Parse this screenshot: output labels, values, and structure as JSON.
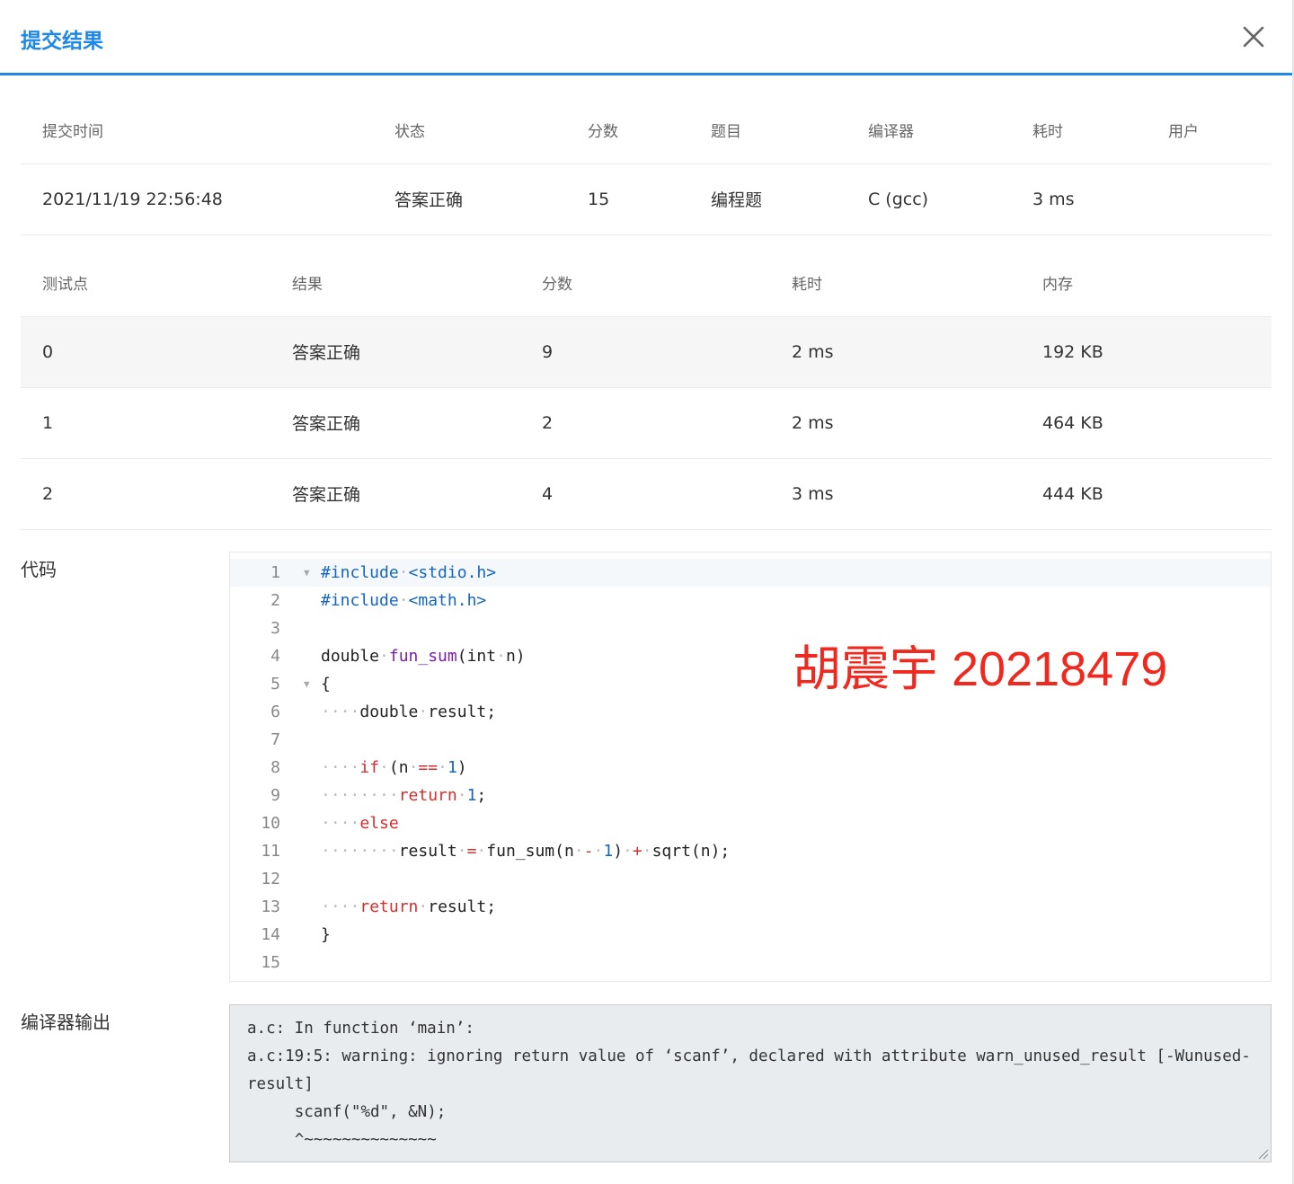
{
  "dialog": {
    "title": "提交结果",
    "close_icon": "close-icon"
  },
  "summary": {
    "headers": [
      "提交时间",
      "状态",
      "分数",
      "题目",
      "编译器",
      "耗时",
      "用户"
    ],
    "row": {
      "submit_time": "2021/11/19 22:56:48",
      "status": "答案正确",
      "score": "15",
      "problem": "编程题",
      "compiler": "C (gcc)",
      "time": "3 ms",
      "user": ""
    }
  },
  "cases": {
    "headers": [
      "测试点",
      "结果",
      "分数",
      "耗时",
      "内存"
    ],
    "rows": [
      {
        "id": "0",
        "result": "答案正确",
        "score": "9",
        "time": "2 ms",
        "memory": "192 KB"
      },
      {
        "id": "1",
        "result": "答案正确",
        "score": "2",
        "time": "2 ms",
        "memory": "464 KB"
      },
      {
        "id": "2",
        "result": "答案正确",
        "score": "4",
        "time": "3 ms",
        "memory": "444 KB"
      }
    ]
  },
  "code_section": {
    "label": "代码",
    "line_numbers": [
      "1",
      "2",
      "3",
      "4",
      "5",
      "6",
      "7",
      "8",
      "9",
      "10",
      "11",
      "12",
      "13",
      "14",
      "15"
    ],
    "lines": [
      "#include <stdio.h>",
      "#include <math.h>",
      "",
      "double fun_sum(int n)",
      "{",
      "    double result;",
      "",
      "    if (n == 1)",
      "        return 1;",
      "    else",
      "        result = fun_sum(n - 1) + sqrt(n);",
      "",
      "    return result;",
      "}",
      ""
    ]
  },
  "watermark": "胡震宇 20218479",
  "compiler_output": {
    "label": "编译器输出",
    "text": "a.c: In function ‘main’:\na.c:19:5: warning: ignoring return value of ‘scanf’, declared with attribute warn_unused_result [-Wunused-result]\n     scanf(\"%d\", &N);\n     ^~~~~~~~~~~~~~~"
  },
  "colors": {
    "accent": "#1e88e5",
    "status_ok": "#e53935",
    "watermark": "#f0281e"
  }
}
